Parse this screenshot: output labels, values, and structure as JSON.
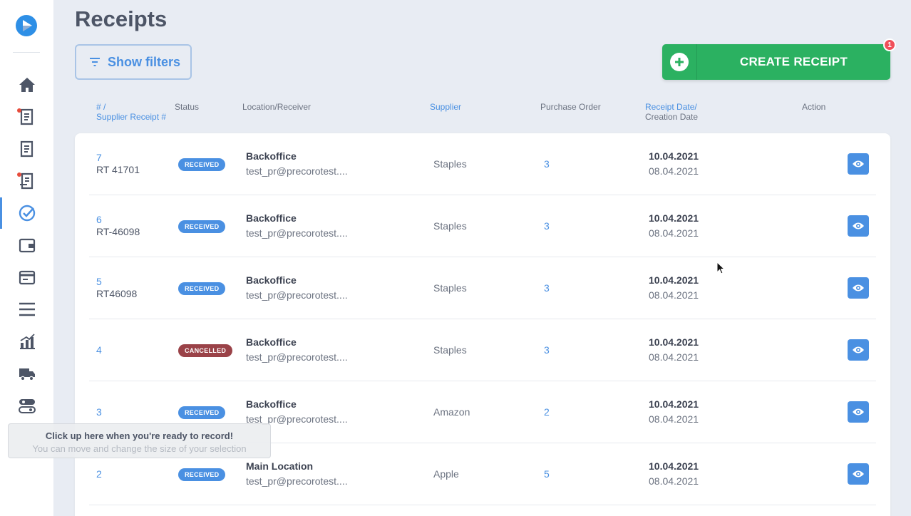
{
  "page": {
    "title": "Receipts"
  },
  "toolbar": {
    "filters_label": "Show filters",
    "create_label": "CREATE RECEIPT",
    "create_badge": "1"
  },
  "columns": {
    "id_line1": "# /",
    "id_line2": "Supplier Receipt #",
    "status": "Status",
    "location": "Location/Receiver",
    "supplier": "Supplier",
    "po": "Purchase Order",
    "date_line1": "Receipt Date/",
    "date_line2": "Creation Date",
    "action": "Action"
  },
  "rows": [
    {
      "id": "7",
      "ref": "RT 41701",
      "status": "RECEIVED",
      "location": "Backoffice",
      "receiver": "test_pr@precorotest....",
      "supplier": "Staples",
      "po": "3",
      "receipt_date": "10.04.2021",
      "creation_date": "08.04.2021"
    },
    {
      "id": "6",
      "ref": "RT-46098",
      "status": "RECEIVED",
      "location": "Backoffice",
      "receiver": "test_pr@precorotest....",
      "supplier": "Staples",
      "po": "3",
      "receipt_date": "10.04.2021",
      "creation_date": "08.04.2021"
    },
    {
      "id": "5",
      "ref": "RT46098",
      "status": "RECEIVED",
      "location": "Backoffice",
      "receiver": "test_pr@precorotest....",
      "supplier": "Staples",
      "po": "3",
      "receipt_date": "10.04.2021",
      "creation_date": "08.04.2021"
    },
    {
      "id": "4",
      "ref": "",
      "status": "CANCELLED",
      "location": "Backoffice",
      "receiver": "test_pr@precorotest....",
      "supplier": "Staples",
      "po": "3",
      "receipt_date": "10.04.2021",
      "creation_date": "08.04.2021"
    },
    {
      "id": "3",
      "ref": "",
      "status": "RECEIVED",
      "location": "Backoffice",
      "receiver": "test_pr@precorotest....",
      "supplier": "Amazon",
      "po": "2",
      "receipt_date": "10.04.2021",
      "creation_date": "08.04.2021"
    },
    {
      "id": "2",
      "ref": "",
      "status": "RECEIVED",
      "location": "Main Location",
      "receiver": "test_pr@precorotest....",
      "supplier": "Apple",
      "po": "5",
      "receipt_date": "10.04.2021",
      "creation_date": "08.04.2021"
    }
  ],
  "recorder": {
    "title": "Click up here when you're ready to record!",
    "subtitle": "You can move and change the size of your selection"
  },
  "colors": {
    "accent": "#4a90e2",
    "create": "#2bb161",
    "received": "#4a90e2",
    "cancelled": "#9a4248",
    "notification": "#f0505a"
  },
  "sidebar_icons": [
    "home-icon",
    "requisition-icon",
    "purchase-order-icon",
    "invoice-icon",
    "receipts-icon",
    "wallet-icon",
    "card-icon",
    "list-icon",
    "analytics-icon",
    "supplier-truck-icon",
    "settings-toggle-icon"
  ]
}
